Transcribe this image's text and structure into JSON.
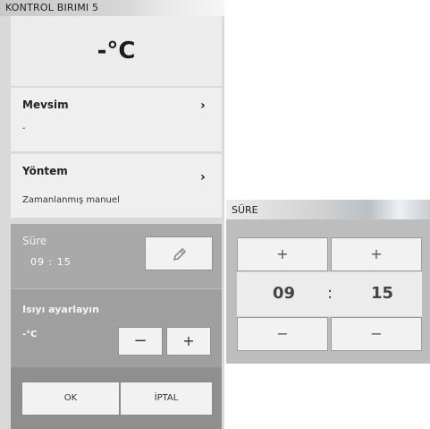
{
  "left_panel": {
    "title": "KONTROL BIRIMI 5",
    "temperature": "-°C",
    "mevsim": {
      "label": "Mevsim",
      "value": "-",
      "icon": "chevron-right-icon"
    },
    "yontem": {
      "label": "Yöntem",
      "value": "Zamanlanmış manuel",
      "icon": "chevron-right-icon"
    },
    "sure": {
      "label": "Süre",
      "time": "09 : 15",
      "edit_icon": "pencil-icon"
    },
    "isi": {
      "label": "Isıyı ayarlayın",
      "value": "-°C",
      "minus": "−",
      "plus": "+"
    },
    "ok_label": "OK",
    "iptal_label": "İPTAL"
  },
  "right_panel": {
    "title": "SÜRE",
    "hours": "09",
    "separator": ":",
    "minutes": "15",
    "plus": "+",
    "minus": "−"
  },
  "colors": {
    "panel_light": "#efefef",
    "panel_mid": "#a9a9a9",
    "panel_dark": "#8f8f8f",
    "button": "#f2f2f2"
  }
}
